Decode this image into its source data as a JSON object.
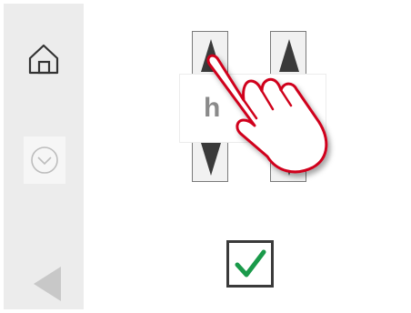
{
  "sidebar": {
    "home_icon": "home-icon",
    "clock_icon": "clock-icon",
    "back_icon": "back-arrow-icon"
  },
  "time_setter": {
    "value_text": "h",
    "up_icon": "triangle-up-icon",
    "down_icon": "triangle-down-icon"
  },
  "gesture": {
    "icon": "pointing-hand-icon"
  },
  "confirm": {
    "icon": "checkmark-icon",
    "check_color": "#1a9a4a"
  },
  "colors": {
    "sidebar_bg": "#ececec",
    "arrow_fill": "#3a3a3a",
    "hand_stroke": "#d0021b",
    "back_arrow": "#c8c8c8"
  }
}
